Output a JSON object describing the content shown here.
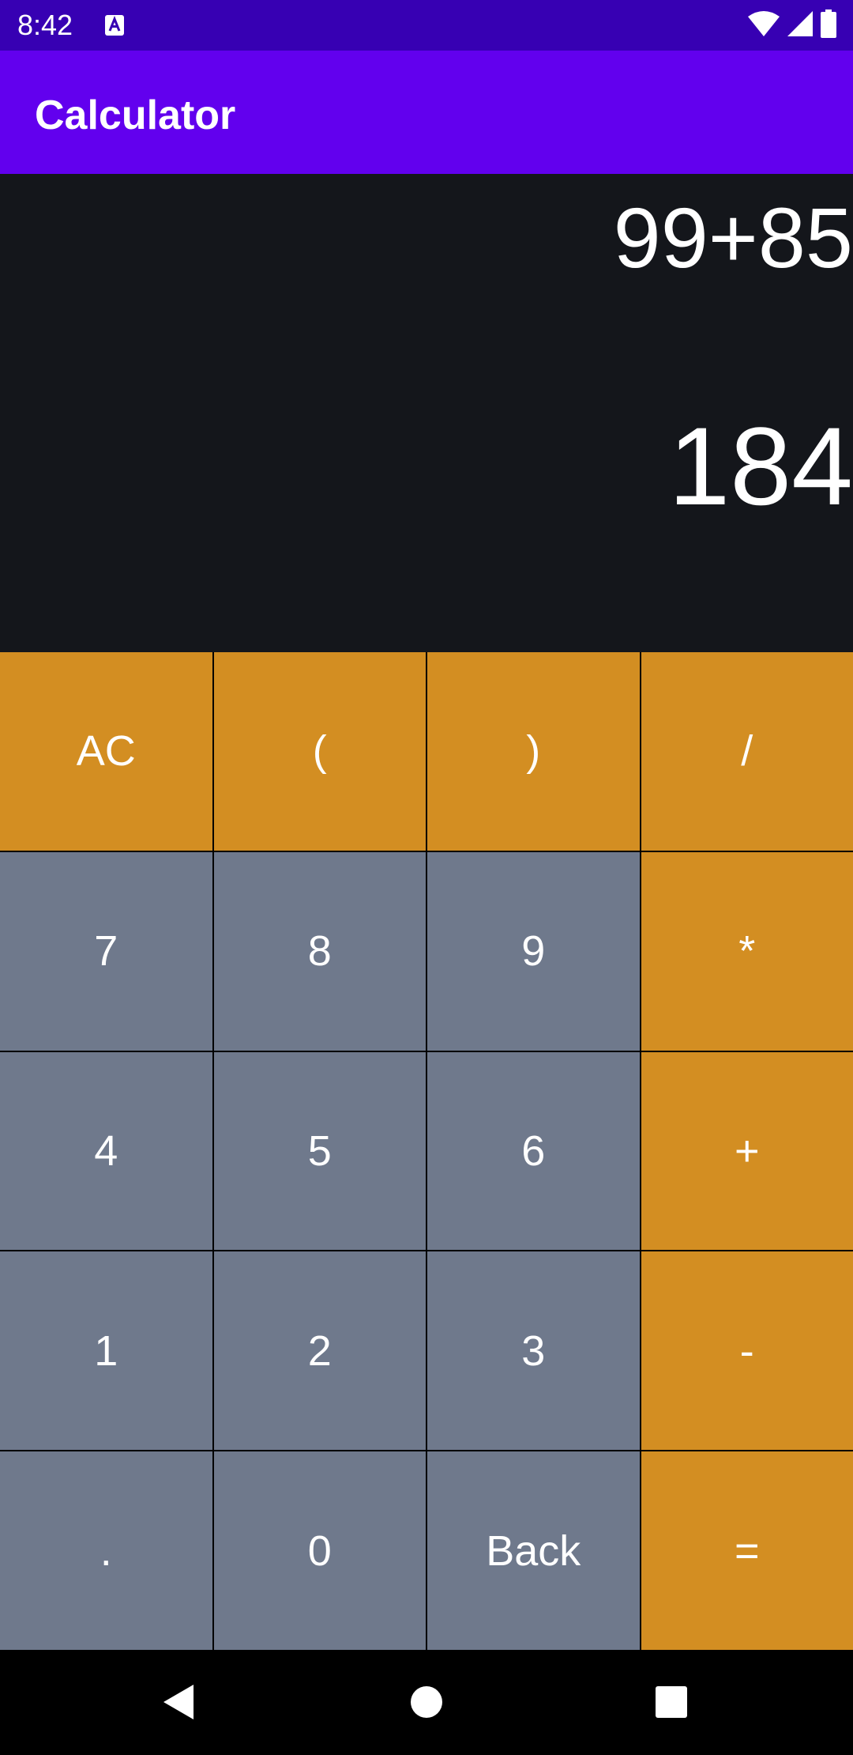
{
  "status_bar": {
    "time": "8:42",
    "icons": [
      "app-notification-icon",
      "wifi-icon",
      "cellular-signal-icon",
      "battery-icon"
    ],
    "background": "#3700B3"
  },
  "app_bar": {
    "title": "Calculator",
    "background": "#6200EE"
  },
  "display": {
    "expression": "99+85",
    "result": "184",
    "background": "#14161B"
  },
  "keypad": {
    "operator_color": "#D38E22",
    "number_color": "#6F798C",
    "rows": [
      [
        {
          "label": "AC",
          "type": "op"
        },
        {
          "label": "(",
          "type": "op"
        },
        {
          "label": ")",
          "type": "op"
        },
        {
          "label": "/",
          "type": "op"
        }
      ],
      [
        {
          "label": "7",
          "type": "num"
        },
        {
          "label": "8",
          "type": "num"
        },
        {
          "label": "9",
          "type": "num"
        },
        {
          "label": "*",
          "type": "op"
        }
      ],
      [
        {
          "label": "4",
          "type": "num"
        },
        {
          "label": "5",
          "type": "num"
        },
        {
          "label": "6",
          "type": "num"
        },
        {
          "label": "+",
          "type": "op"
        }
      ],
      [
        {
          "label": "1",
          "type": "num"
        },
        {
          "label": "2",
          "type": "num"
        },
        {
          "label": "3",
          "type": "num"
        },
        {
          "label": "-",
          "type": "op"
        }
      ],
      [
        {
          "label": ".",
          "type": "num"
        },
        {
          "label": "0",
          "type": "num"
        },
        {
          "label": "Back",
          "type": "num"
        },
        {
          "label": "=",
          "type": "op"
        }
      ]
    ]
  },
  "nav_bar": {
    "buttons": [
      "back-icon",
      "home-icon",
      "recents-icon"
    ]
  }
}
